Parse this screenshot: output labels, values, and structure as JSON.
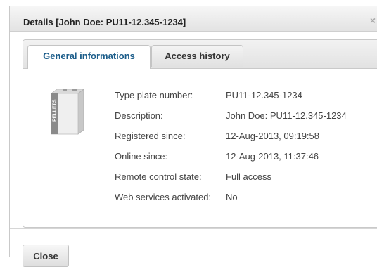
{
  "dialog": {
    "title": "Details [John Doe: PU11-12.345-1234]",
    "close_glyph": "×",
    "close_icon": "close-icon"
  },
  "tabs": [
    {
      "label": "General informations",
      "active": true
    },
    {
      "label": "Access history",
      "active": false
    }
  ],
  "device": {
    "image_icon": "pellet-boiler-image",
    "image_text": "PELLETS"
  },
  "details": [
    {
      "label": "Type plate number:",
      "value": "PU11-12.345-1234"
    },
    {
      "label": "Description:",
      "value": "John Doe: PU11-12.345-1234"
    },
    {
      "label": "Registered since:",
      "value": "12-Aug-2013, 09:19:58"
    },
    {
      "label": "Online since:",
      "value": "12-Aug-2013, 11:37:46"
    },
    {
      "label": "Remote control state:",
      "value": "Full access"
    },
    {
      "label": "Web services activated:",
      "value": "No"
    }
  ],
  "footer": {
    "close_label": "Close"
  },
  "colors": {
    "active_tab_text": "#1c5d8a",
    "panel_border": "#c9c9c9"
  }
}
